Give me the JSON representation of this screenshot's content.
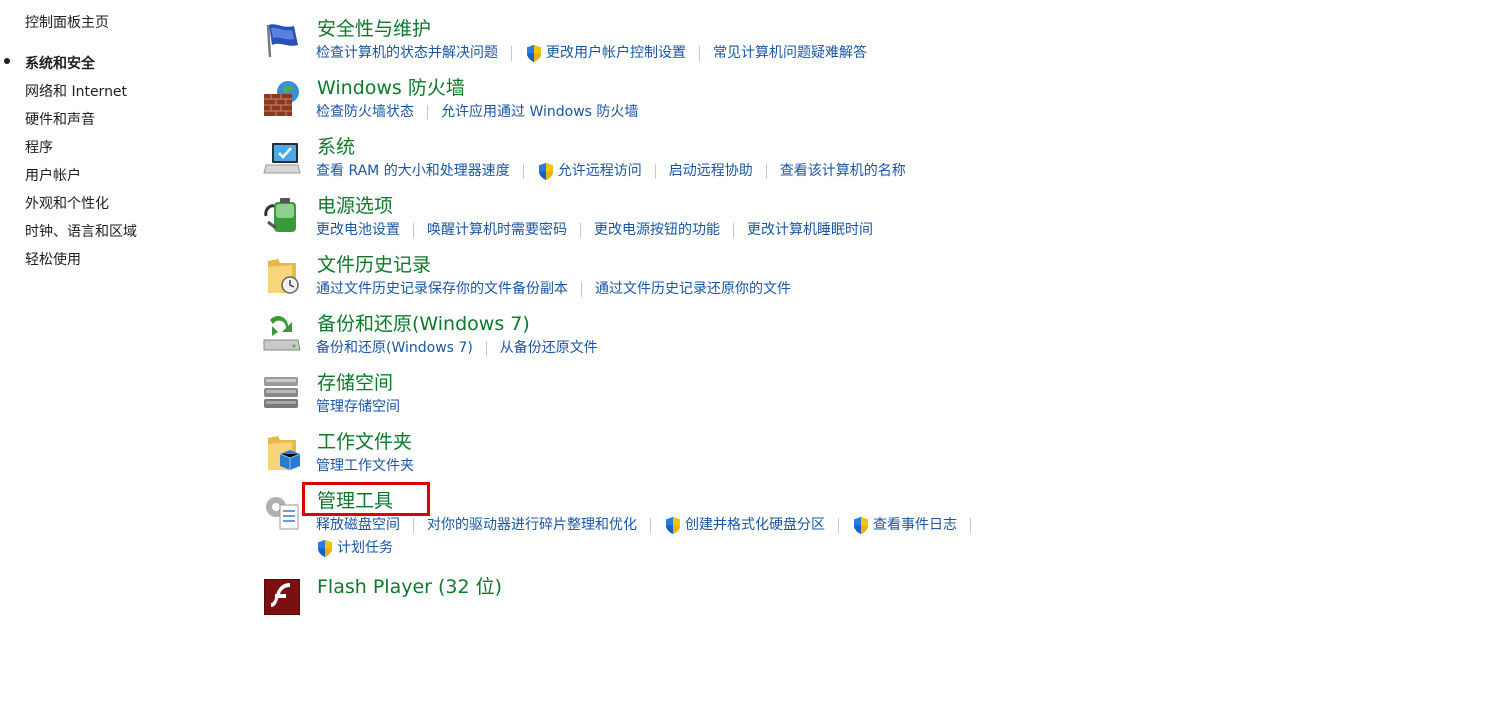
{
  "nav": {
    "home": "控制面板主页",
    "items": [
      "系统和安全",
      "网络和 Internet",
      "硬件和声音",
      "程序",
      "用户帐户",
      "外观和个性化",
      "时钟、语言和区域",
      "轻松使用"
    ]
  },
  "categories": {
    "security": {
      "title": "安全性与维护",
      "links": [
        "检查计算机的状态并解决问题",
        "更改用户帐户控制设置",
        "常见计算机问题疑难解答"
      ]
    },
    "firewall": {
      "title": "Windows 防火墙",
      "links": [
        "检查防火墙状态",
        "允许应用通过 Windows 防火墙"
      ]
    },
    "system": {
      "title": "系统",
      "links": [
        "查看 RAM 的大小和处理器速度",
        "允许远程访问",
        "启动远程协助",
        "查看该计算机的名称"
      ]
    },
    "power": {
      "title": "电源选项",
      "links": [
        "更改电池设置",
        "唤醒计算机时需要密码",
        "更改电源按钮的功能",
        "更改计算机睡眠时间"
      ]
    },
    "filehistory": {
      "title": "文件历史记录",
      "links": [
        "通过文件历史记录保存你的文件备份副本",
        "通过文件历史记录还原你的文件"
      ]
    },
    "backup": {
      "title": "备份和还原(Windows 7)",
      "links": [
        "备份和还原(Windows 7)",
        "从备份还原文件"
      ]
    },
    "storage": {
      "title": "存储空间",
      "links": [
        "管理存储空间"
      ]
    },
    "workfolders": {
      "title": "工作文件夹",
      "links": [
        "管理工作文件夹"
      ]
    },
    "admintools": {
      "title": "管理工具",
      "links": [
        "释放磁盘空间",
        "对你的驱动器进行碎片整理和优化",
        "创建并格式化硬盘分区",
        "查看事件日志",
        "计划任务"
      ]
    },
    "flash": {
      "title": "Flash Player (32 位)"
    }
  },
  "colors": {
    "title_green": "#0c7a29",
    "link_blue": "#1a56a6",
    "highlight_red": "#e00000"
  },
  "icons": {
    "security": "flag-icon",
    "firewall": "brick-wall-globe-icon",
    "system": "computer-monitor-icon",
    "power": "battery-icon",
    "filehistory": "folder-clock-icon",
    "backup": "drive-backup-icon",
    "storage": "stacked-drives-icon",
    "workfolders": "folder-blue-icon",
    "admintools": "gear-document-icon",
    "flash": "flash-player-icon",
    "uac": "uac-shield-icon"
  }
}
